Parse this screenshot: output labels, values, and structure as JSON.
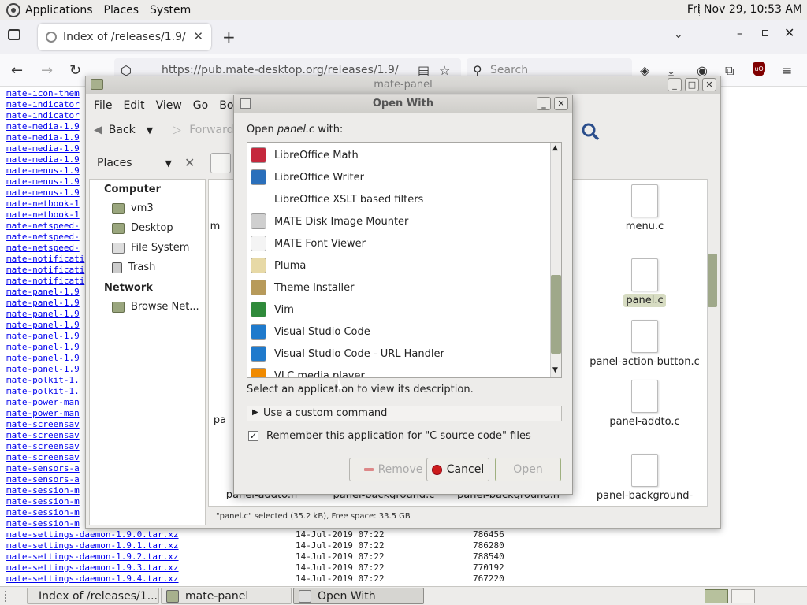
{
  "top_panel": {
    "menus": [
      "Applications",
      "Places",
      "System"
    ],
    "clock": "Fri Nov 29, 10:53 AM"
  },
  "browser": {
    "tab_title": "Index of /releases/1.9/",
    "url": "https://pub.mate-desktop.org/releases/1.9/",
    "search_placeholder": "Search",
    "listing_links": [
      "mate-icon-them",
      "mate-indicator",
      "mate-indicator",
      "mate-media-1.9",
      "mate-media-1.9",
      "mate-media-1.9",
      "mate-media-1.9",
      "mate-menus-1.9",
      "mate-menus-1.9",
      "mate-menus-1.9",
      "mate-netbook-1",
      "mate-netbook-1",
      "mate-netspeed-",
      "mate-netspeed-",
      "mate-netspeed-",
      "mate-notificati",
      "mate-notificati",
      "mate-notificati",
      "mate-panel-1.9",
      "mate-panel-1.9",
      "mate-panel-1.9",
      "mate-panel-1.9",
      "mate-panel-1.9",
      "mate-panel-1.9",
      "mate-panel-1.9",
      "mate-panel-1.9",
      "mate-polkit-1.",
      "mate-polkit-1.",
      "mate-power-man",
      "mate-power-man",
      "mate-screensav",
      "mate-screensav",
      "mate-screensav",
      "mate-screensav",
      "mate-sensors-a",
      "mate-sensors-a",
      "mate-session-m",
      "mate-session-m",
      "mate-session-m",
      "mate-session-m"
    ],
    "bottom_rows": [
      {
        "name": "mate-settings-daemon-1.9.0.tar.xz",
        "date": "14-Jul-2019 07:22",
        "size": "786456"
      },
      {
        "name": "mate-settings-daemon-1.9.1.tar.xz",
        "date": "14-Jul-2019 07:22",
        "size": "786280"
      },
      {
        "name": "mate-settings-daemon-1.9.2.tar.xz",
        "date": "14-Jul-2019 07:22",
        "size": "788540"
      },
      {
        "name": "mate-settings-daemon-1.9.3.tar.xz",
        "date": "14-Jul-2019 07:22",
        "size": "770192"
      },
      {
        "name": "mate-settings-daemon-1.9.4.tar.xz",
        "date": "14-Jul-2019 07:22",
        "size": "767220"
      }
    ]
  },
  "caja": {
    "title": "mate-panel",
    "menu": [
      "File",
      "Edit",
      "View",
      "Go",
      "Bookm"
    ],
    "back_label": "Back",
    "forward_label": "Forward",
    "places_label": "Places",
    "sidebar": {
      "computer_heading": "Computer",
      "computer_items": [
        "vm3",
        "Desktop",
        "File System",
        "Trash"
      ],
      "network_heading": "Network",
      "network_items": [
        "Browse Net..."
      ]
    },
    "files": {
      "menu_c": "menu.c",
      "panel_c": "panel.c",
      "panel_action_button": "panel-action-button.c",
      "panel_addto": "panel-addto.c",
      "panel_background": "panel-background-",
      "bottom_cut_1": "panel-addto.h",
      "bottom_cut_2": "panel-background.c",
      "bottom_cut_3": "panel-background.h",
      "left_cut_1": "m",
      "left_cut_2": "pa"
    },
    "status": "\"panel.c\" selected (35.2 kB), Free space: 33.5 GB"
  },
  "dialog": {
    "title": "Open With",
    "prompt_prefix": "Open ",
    "prompt_file": "panel.c",
    "prompt_suffix": " with:",
    "apps": [
      {
        "name": "LibreOffice Math",
        "icon": "libreoffice-math-icon",
        "color": "#c5283d"
      },
      {
        "name": "LibreOffice Writer",
        "icon": "libreoffice-writer-icon",
        "color": "#2a6fbb"
      },
      {
        "name": "LibreOffice XSLT based filters",
        "icon": "",
        "color": ""
      },
      {
        "name": "MATE Disk Image Mounter",
        "icon": "disk-image-icon",
        "color": "#cfcfcf"
      },
      {
        "name": "MATE Font Viewer",
        "icon": "font-viewer-icon",
        "color": "#f4f4f4"
      },
      {
        "name": "Pluma",
        "icon": "pluma-icon",
        "color": "#e7d9a6"
      },
      {
        "name": "Theme Installer",
        "icon": "theme-installer-icon",
        "color": "#b79a5a"
      },
      {
        "name": "Vim",
        "icon": "vim-icon",
        "color": "#2f8a3a"
      },
      {
        "name": "Visual Studio Code",
        "icon": "vscode-icon",
        "color": "#1f7acc"
      },
      {
        "name": "Visual Studio Code - URL Handler",
        "icon": "vscode-icon",
        "color": "#1f7acc"
      },
      {
        "name": "VLC media player",
        "icon": "vlc-icon",
        "color": "#f08a00"
      }
    ],
    "description": "Select an application to view its description.",
    "custom_command": "Use a custom command",
    "remember": "Remember this application for \"C source code\" files",
    "remember_checked": true,
    "buttons": {
      "remove": "Remove",
      "cancel": "Cancel",
      "open": "Open"
    }
  },
  "taskbar": {
    "items": [
      "Index of /releases/1....",
      "mate-panel",
      "Open With"
    ]
  }
}
